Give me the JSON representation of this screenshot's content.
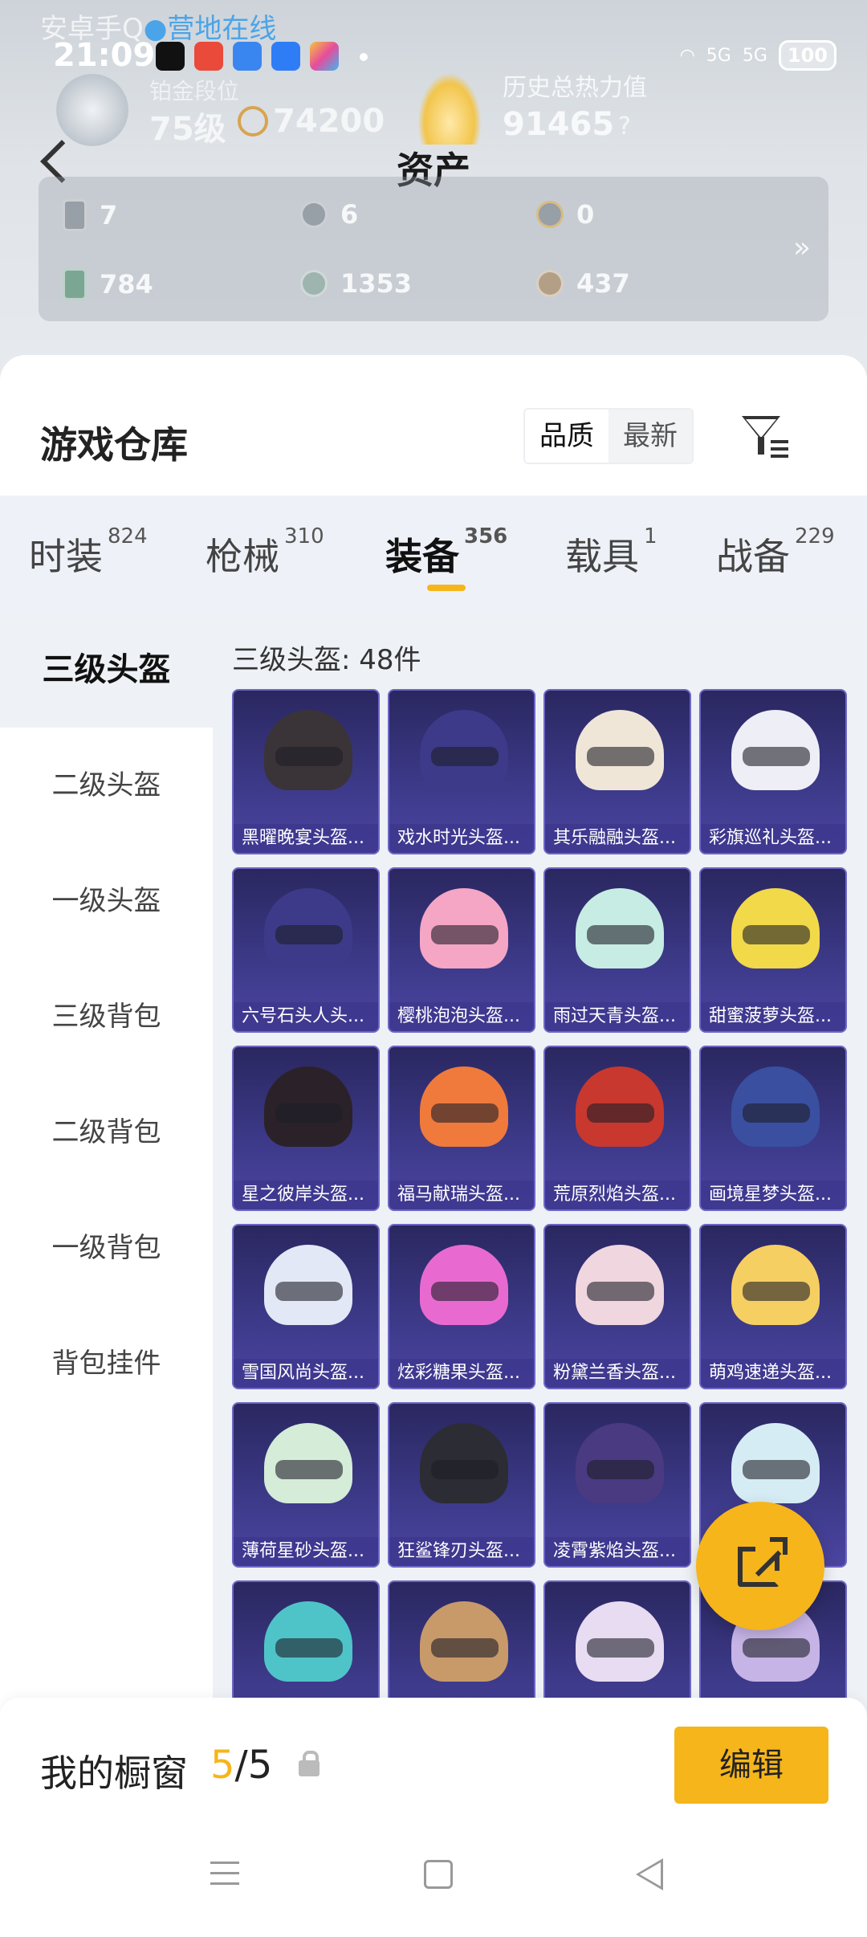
{
  "status_bar": {
    "time": "21:09",
    "network": "5G",
    "battery": "100",
    "camp_prefix": "安卓手Q",
    "camp_status": "●营地在线"
  },
  "profile": {
    "rank_name": "铂金段位",
    "rank_level": "75级",
    "rank_points": "74200",
    "heat_label": "历史总热力值",
    "heat_value": "91465",
    "heat_help": "?"
  },
  "header": {
    "title": "资产",
    "back_icon": "chevron-left-icon"
  },
  "assets": [
    {
      "icon": "card-icon",
      "value": "7"
    },
    {
      "icon": "silver-coin-icon",
      "value": "6"
    },
    {
      "icon": "gold-coin-icon",
      "value": "0"
    },
    {
      "icon": "green-card-icon",
      "value": "784"
    },
    {
      "icon": "silver-medal-icon",
      "value": "1353"
    },
    {
      "icon": "bronze-medal-icon",
      "value": "437"
    }
  ],
  "assets_more": "»",
  "warehouse": {
    "title": "游戏仓库",
    "sort_options": [
      "品质",
      "最新"
    ],
    "sort_active": "品质"
  },
  "tabs": [
    {
      "label": "时装",
      "count": "824"
    },
    {
      "label": "枪械",
      "count": "310"
    },
    {
      "label": "装备",
      "count": "356",
      "active": true
    },
    {
      "label": "载具",
      "count": "1"
    },
    {
      "label": "战备",
      "count": "229"
    }
  ],
  "categories": [
    "三级头盔",
    "二级头盔",
    "一级头盔",
    "三级背包",
    "二级背包",
    "一级背包",
    "背包挂件"
  ],
  "category_active": "三级头盔",
  "count_label": "三级头盔: 48件",
  "items": [
    {
      "name": "黑曜晚宴头盔...",
      "color": "#3a3438"
    },
    {
      "name": "戏水时光头盔...",
      "color": "#3d3a8a"
    },
    {
      "name": "其乐融融头盔...",
      "color": "#efe6d8"
    },
    {
      "name": "彩旗巡礼头盔...",
      "color": "#eeeef6"
    },
    {
      "name": "六号石头人头...",
      "color": "#3d3a8a"
    },
    {
      "name": "樱桃泡泡头盔...",
      "color": "#f4a6c4"
    },
    {
      "name": "雨过天青头盔...",
      "color": "#c7ece4"
    },
    {
      "name": "甜蜜菠萝头盔...",
      "color": "#f2d94a"
    },
    {
      "name": "星之彼岸头盔...",
      "color": "#2a2228"
    },
    {
      "name": "福马献瑞头盔...",
      "color": "#ef7a3c"
    },
    {
      "name": "荒原烈焰头盔...",
      "color": "#c8382e"
    },
    {
      "name": "画境星梦头盔...",
      "color": "#3a4fa0"
    },
    {
      "name": "雪国风尚头盔...",
      "color": "#e2e8f6"
    },
    {
      "name": "炫彩糖果头盔...",
      "color": "#e86ad0"
    },
    {
      "name": "粉黛兰香头盔...",
      "color": "#f0d6de"
    },
    {
      "name": "萌鸡速递头盔...",
      "color": "#f6cf62"
    },
    {
      "name": "薄荷星砂头盔...",
      "color": "#d4ecd8"
    },
    {
      "name": "狂鲨锋刃头盔...",
      "color": "#2c2c34"
    },
    {
      "name": "凌霄紫焰头盔...",
      "color": "#4a3a82"
    },
    {
      "name": "",
      "color": "#d6ecf4"
    },
    {
      "name": "",
      "color": "#4fc4c8"
    },
    {
      "name": "",
      "color": "#c89a6a"
    },
    {
      "name": "",
      "color": "#e8dcf2"
    },
    {
      "name": "",
      "color": "#c6b4e6"
    }
  ],
  "showcase": {
    "title": "我的橱窗",
    "current": "5",
    "separator": "/",
    "max": "5",
    "edit_label": "编辑"
  },
  "colors": {
    "accent": "#f6b51a",
    "tile_bg": "#3d3a8a"
  }
}
